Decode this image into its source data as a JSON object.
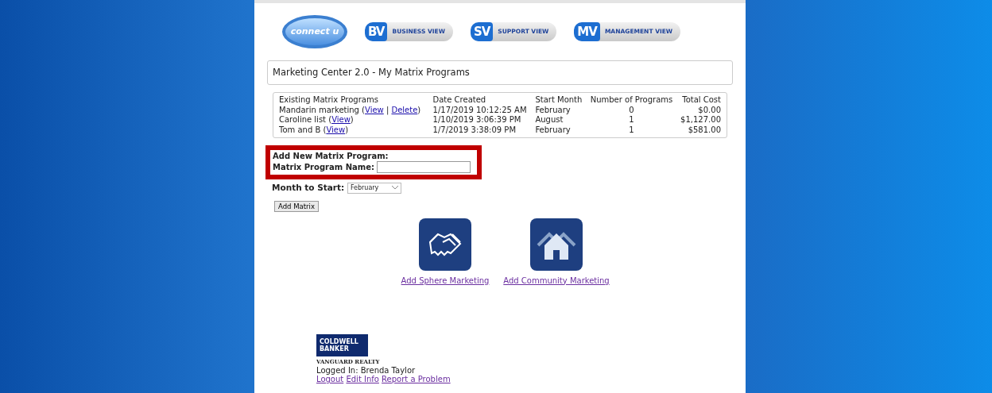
{
  "header": {
    "logo": {
      "text": "connect u"
    },
    "views": [
      {
        "abbr": "BV",
        "label": "BUSINESS VIEW"
      },
      {
        "abbr": "SV",
        "label": "SUPPORT VIEW"
      },
      {
        "abbr": "MV",
        "label": "MANAGEMENT VIEW"
      }
    ]
  },
  "panel_title": "Marketing Center 2.0 - My Matrix Programs",
  "table": {
    "columns": [
      "Existing Matrix Programs",
      "Date Created",
      "Start Month",
      "Number of Programs",
      "Total Cost"
    ],
    "rows": [
      {
        "program": [
          {
            "kind": "text",
            "text": "Mandarin marketing ("
          },
          {
            "kind": "link",
            "text": "View"
          },
          {
            "kind": "text",
            "text": " | "
          },
          {
            "kind": "link",
            "text": "Delete"
          },
          {
            "kind": "text",
            "text": ")"
          }
        ],
        "date": "1/17/2019 10:12:25 AM",
        "month": "February",
        "count": "0",
        "cost": "$0.00"
      },
      {
        "program": [
          {
            "kind": "text",
            "text": "Caroline list ("
          },
          {
            "kind": "link",
            "text": "View"
          },
          {
            "kind": "text",
            "text": ")"
          }
        ],
        "date": "1/10/2019 3:06:39 PM",
        "month": "August",
        "count": "1",
        "cost": "$1,127.00"
      },
      {
        "program": [
          {
            "kind": "text",
            "text": "Tom and B ("
          },
          {
            "kind": "link",
            "text": "View"
          },
          {
            "kind": "text",
            "text": ")"
          }
        ],
        "date": "1/7/2019 3:38:09 PM",
        "month": "February",
        "count": "1",
        "cost": "$581.00"
      }
    ]
  },
  "form": {
    "heading": "Add New Matrix Program:",
    "name_label": "Matrix Program Name:",
    "month_label": "Month to Start:",
    "month_value": "February",
    "button": "Add Matrix"
  },
  "tiles": [
    {
      "kind": "handshake",
      "label": "Add Sphere Marketing"
    },
    {
      "kind": "houses",
      "label": "Add Community Marketing"
    }
  ],
  "footer": {
    "brand": [
      "COLDWELL",
      "BANKER"
    ],
    "brand_sub": "VANGUARD REALTY",
    "logged_in": "Logged In: Brenda Taylor",
    "links": [
      "Logout",
      "Edit Info",
      "Report a Problem"
    ]
  }
}
